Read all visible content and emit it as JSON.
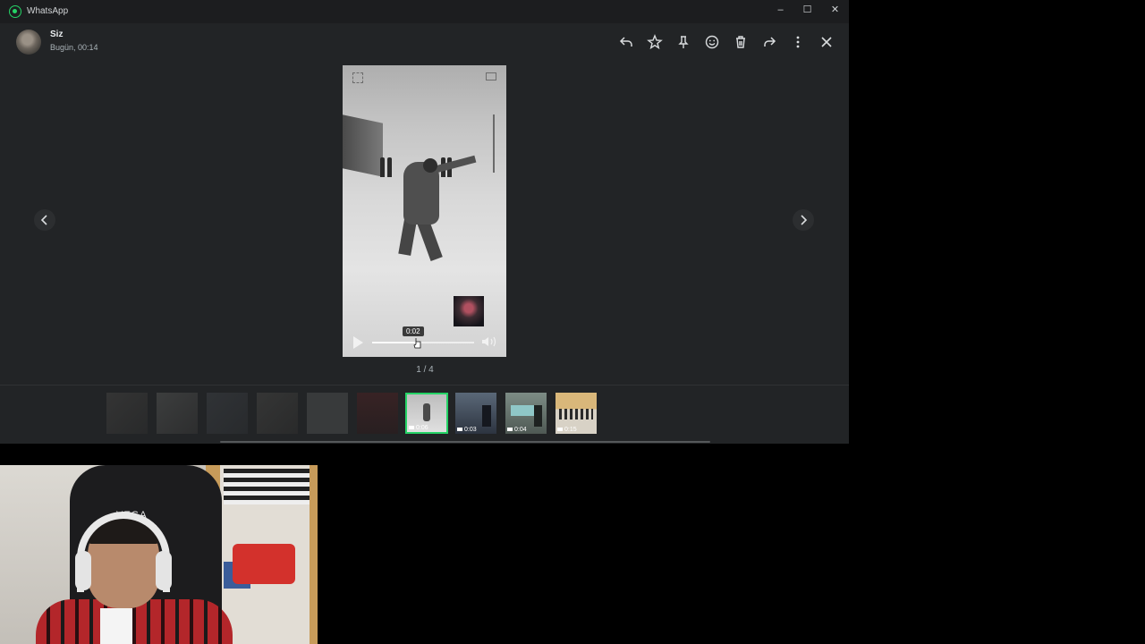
{
  "window": {
    "title": "WhatsApp",
    "controls": {
      "minimize": "–",
      "maximize": "☐",
      "close": "✕"
    }
  },
  "header": {
    "sender": "Siz",
    "timestamp": "Bugün, 00:14",
    "actions": [
      "reply-icon",
      "star-icon",
      "pin-icon",
      "emoji-icon",
      "delete-icon",
      "forward-icon",
      "more-icon",
      "close-icon"
    ]
  },
  "player": {
    "current_time": "0:02",
    "progress": 0.44
  },
  "counter": "1 / 4",
  "thumbnails": [
    {
      "type": "image",
      "dim": true
    },
    {
      "type": "image",
      "dim": true
    },
    {
      "type": "image",
      "dim": true
    },
    {
      "type": "image",
      "dim": true
    },
    {
      "type": "image",
      "dim": true
    },
    {
      "type": "image",
      "dim": true
    },
    {
      "type": "video",
      "duration": "0:06",
      "selected": true
    },
    {
      "type": "video",
      "duration": "0:03"
    },
    {
      "type": "video",
      "duration": "0:04"
    },
    {
      "type": "video",
      "duration": "0:15"
    }
  ],
  "webcam": {
    "chair_brand": "VEGA"
  },
  "colors": {
    "accent": "#25d366",
    "background": "#222426",
    "titlebar": "#1c1d1f"
  }
}
